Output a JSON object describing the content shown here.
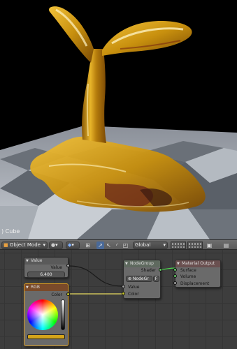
{
  "viewport": {
    "object_label": ") Cube"
  },
  "header": {
    "mode_label": "Object Mode",
    "orientation_label": "Global",
    "icons": [
      "view-menu-icon",
      "viewport-shading-icon",
      "pivot-icon",
      "snap-icon",
      "manipulator-translate-icon",
      "manipulator-rotate-icon",
      "manipulator-scale-icon",
      "layers-icon",
      "lock-icon",
      "render-icon"
    ]
  },
  "nodes": {
    "value": {
      "title": "Value",
      "output_label": "Value",
      "field_value": "6.400"
    },
    "rgb": {
      "title": "RGB",
      "output_label": "Color",
      "color": "#d4a41a"
    },
    "group": {
      "title": "NodeGroup",
      "output_label": "Shader",
      "datablock": "NodeGr",
      "datablock_users": "F",
      "input_value": "Value",
      "input_color": "Color"
    },
    "output": {
      "title": "Material Output",
      "surface": "Surface",
      "volume": "Volume",
      "displacement": "Displacement"
    }
  },
  "colors": {
    "honey": "#c8900e",
    "accent": "#e0a020",
    "editor_bg": "#3d3d3d"
  }
}
